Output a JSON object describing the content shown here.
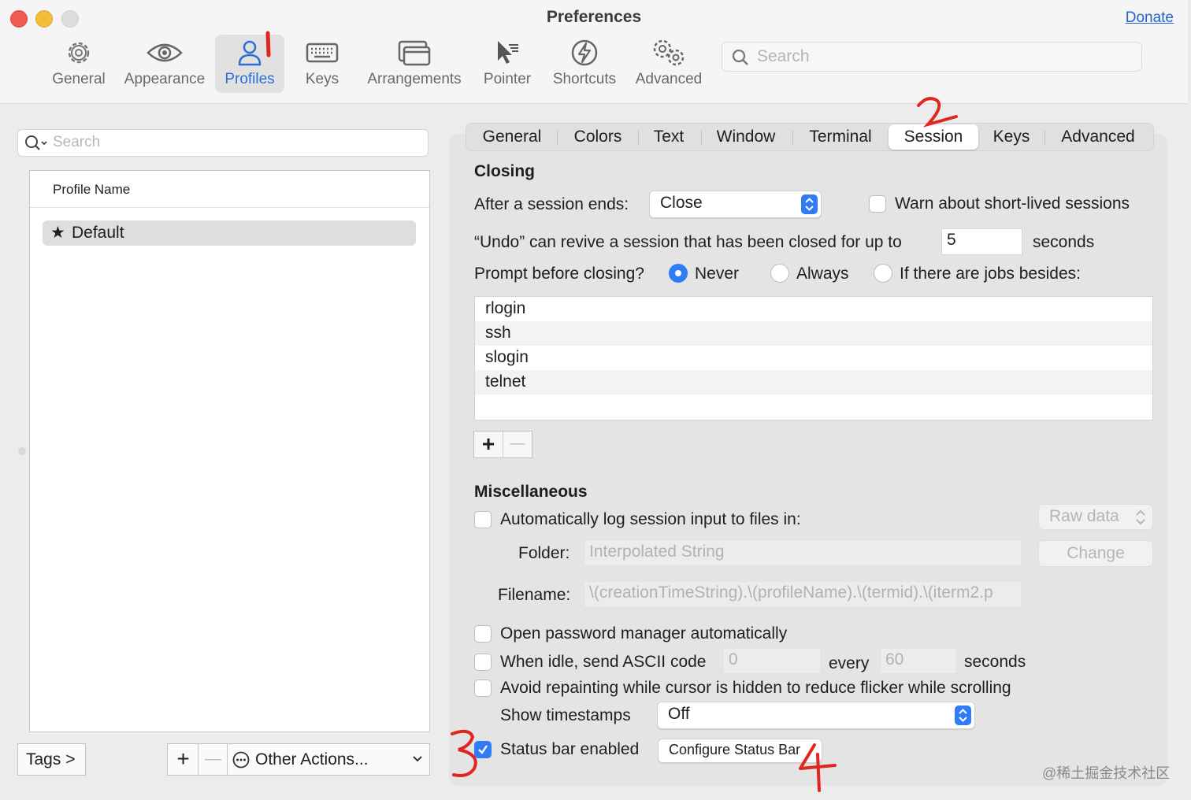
{
  "window": {
    "title": "Preferences",
    "donate": "Donate"
  },
  "toolbar": {
    "items": [
      {
        "label": "General",
        "icon": "gear-icon"
      },
      {
        "label": "Appearance",
        "icon": "eye-icon"
      },
      {
        "label": "Profiles",
        "icon": "person-icon",
        "selected": true
      },
      {
        "label": "Keys",
        "icon": "keyboard-icon"
      },
      {
        "label": "Arrangements",
        "icon": "window-stack-icon"
      },
      {
        "label": "Pointer",
        "icon": "cursor-icon"
      },
      {
        "label": "Shortcuts",
        "icon": "lightning-icon"
      },
      {
        "label": "Advanced",
        "icon": "gears-icon"
      }
    ],
    "search_placeholder": "Search"
  },
  "profiles": {
    "search_placeholder": "Search",
    "column_header": "Profile Name",
    "rows": [
      {
        "name": "Default",
        "star": "★"
      }
    ],
    "tags_button": "Tags >",
    "add": "+",
    "remove": "—",
    "other_actions": "Other Actions..."
  },
  "tabs": [
    "General",
    "Colors",
    "Text",
    "Window",
    "Terminal",
    "Session",
    "Keys",
    "Advanced"
  ],
  "active_tab": "Session",
  "closing": {
    "heading": "Closing",
    "after_session_label": "After a session ends:",
    "after_session_value": "Close",
    "warn_short_lived": "Warn about short-lived sessions",
    "undo_prefix": "“Undo” can revive a session that has been closed for up to",
    "undo_value": "5",
    "undo_suffix": "seconds",
    "prompt_label": "Prompt before closing?",
    "radio_never": "Never",
    "radio_always": "Always",
    "radio_jobs": "If there are jobs besides:",
    "prompt_selected": "Never",
    "jobs": [
      "rlogin",
      "ssh",
      "slogin",
      "telnet"
    ],
    "add": "+",
    "remove": "—"
  },
  "misc": {
    "heading": "Miscellaneous",
    "auto_log": "Automatically log session input to files in:",
    "raw_data": "Raw data",
    "folder_label": "Folder:",
    "folder_placeholder": "Interpolated String",
    "change": "Change",
    "filename_label": "Filename:",
    "filename_value": "\\(creationTimeString).\\(profileName).\\(termid).\\(iterm2.p",
    "open_password": "Open password manager automatically",
    "idle_prefix": "When idle, send ASCII code",
    "idle_code": "0",
    "idle_every": "every",
    "idle_seconds_value": "60",
    "idle_seconds": "seconds",
    "avoid_repaint": "Avoid repainting while cursor is hidden to reduce flicker while scrolling",
    "show_timestamps": "Show timestamps",
    "timestamps_value": "Off",
    "status_bar": "Status bar enabled",
    "status_bar_checked": true,
    "configure_status_bar": "Configure Status Bar"
  },
  "watermark": "@稀土掘金技术社区",
  "colors": {
    "accent": "#2f7cf6",
    "annotation_red": "#e0261f",
    "link": "#2463c7"
  }
}
